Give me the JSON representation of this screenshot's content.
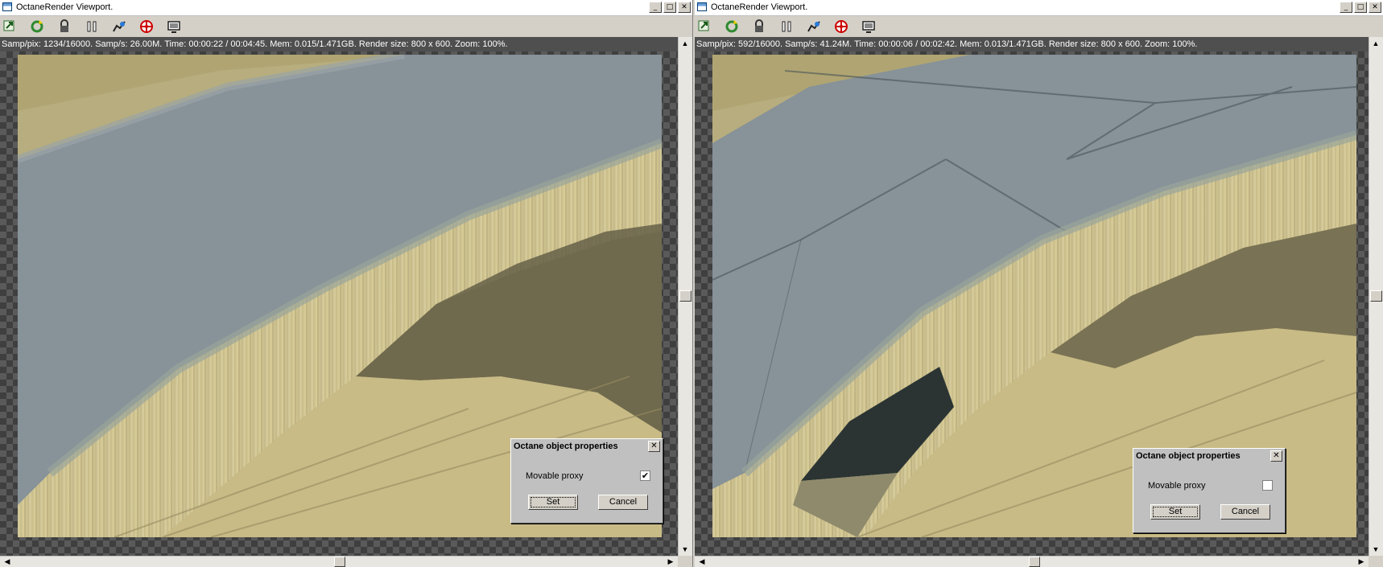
{
  "left_window": {
    "title": "OctaneRender Viewport.",
    "status": "Samp/pix: 1234/16000.   Samp/s: 26.00M.   Time: 00:00:22 / 00:04:45.   Mem: 0.015/1.471GB.   Render size: 800 x 600.   Zoom: 100%.",
    "dialog": {
      "title": "Octane object properties",
      "close_glyph": "✕",
      "checkbox_label": "Movable proxy",
      "checked_glyph": "✔",
      "checked": true,
      "set_label": "Set",
      "cancel_label": "Cancel"
    }
  },
  "right_window": {
    "title": "OctaneRender Viewport.",
    "status": "Samp/pix: 592/16000.   Samp/s: 41.24M.   Time: 00:00:06 / 00:02:42.   Mem: 0.013/1.471GB.   Render size: 800 x 600.   Zoom: 100%.",
    "dialog": {
      "title": "Octane object properties",
      "close_glyph": "✕",
      "checkbox_label": "Movable proxy",
      "checked_glyph": "",
      "checked": false,
      "set_label": "Set",
      "cancel_label": "Cancel"
    }
  },
  "caption_buttons": {
    "minimize": "_",
    "maximize": "□",
    "close": "✕"
  },
  "toolbar_icons": [
    "export-icon",
    "refresh-icon",
    "lock-icon",
    "pause-icon",
    "graph-icon",
    "target-icon",
    "monitor-icon"
  ],
  "scroll_arrows": {
    "up": "▲",
    "down": "▼",
    "left": "◀",
    "right": "▶"
  },
  "colors": {
    "status_bg": "#4f4f4f",
    "window_bg": "#d4d0c8",
    "dialog_bg": "#c0c0c0"
  }
}
